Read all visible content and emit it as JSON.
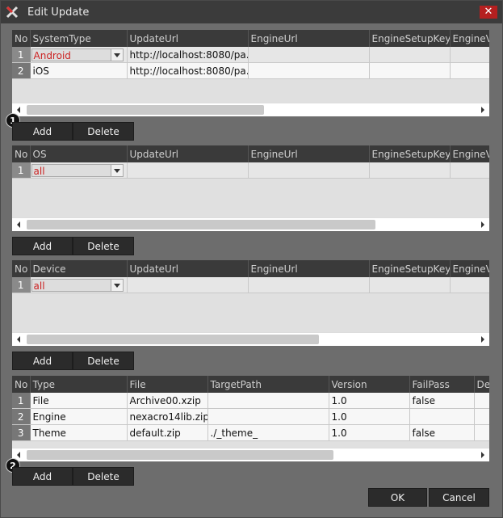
{
  "window": {
    "title": "Edit Update",
    "close_symbol": "✕"
  },
  "grid1": {
    "headers": [
      "No",
      "SystemType",
      "UpdateUrl",
      "EngineUrl",
      "EngineSetupKey",
      "EngineVe"
    ],
    "rows": [
      {
        "no": "1",
        "c1": "Android",
        "c2": "http://localhost:8080/pa...",
        "c3": "",
        "c4": "",
        "c5": ""
      },
      {
        "no": "2",
        "c1": "iOS",
        "c2": "http://localhost:8080/pa...",
        "c3": "",
        "c4": "",
        "c5": ""
      }
    ]
  },
  "grid2": {
    "headers": [
      "No",
      "OS",
      "UpdateUrl",
      "EngineUrl",
      "EngineSetupKey",
      "EngineVe"
    ],
    "rows": [
      {
        "no": "1",
        "c1": "all",
        "c2": "",
        "c3": "",
        "c4": "",
        "c5": ""
      }
    ]
  },
  "grid3": {
    "headers": [
      "No",
      "Device",
      "UpdateUrl",
      "EngineUrl",
      "EngineSetupKey",
      "EngineVe"
    ],
    "rows": [
      {
        "no": "1",
        "c1": "all",
        "c2": "",
        "c3": "",
        "c4": "",
        "c5": ""
      }
    ]
  },
  "grid4": {
    "headers": [
      "No",
      "Type",
      "File",
      "TargetPath",
      "Version",
      "FailPass",
      "Des"
    ],
    "rows": [
      {
        "no": "1",
        "c1": "File",
        "c2": "Archive00.xzip",
        "c3": "",
        "c4": "1.0",
        "c5": "false",
        "c6": ""
      },
      {
        "no": "2",
        "c1": "Engine",
        "c2": "nexacro14lib.zip",
        "c3": "",
        "c4": "1.0",
        "c5": "",
        "c6": ""
      },
      {
        "no": "3",
        "c1": "Theme",
        "c2": "default.zip",
        "c3": "./_theme_",
        "c4": "1.0",
        "c5": "false",
        "c6": ""
      }
    ]
  },
  "buttons": {
    "add": "Add",
    "delete": "Delete",
    "ok": "OK",
    "cancel": "Cancel"
  },
  "badges": {
    "first": "1",
    "second": "2"
  },
  "colors": {
    "title_bar": "#3b3b3b",
    "close_button": "#b52020",
    "combo_text": "#cc2222"
  }
}
